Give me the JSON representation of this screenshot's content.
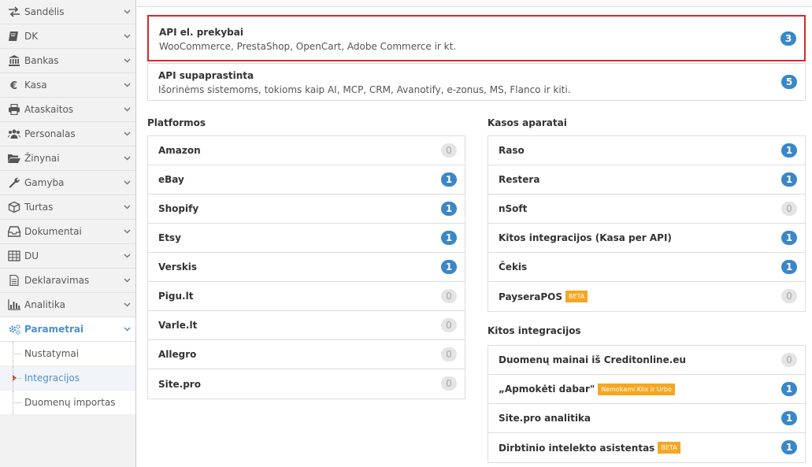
{
  "sidebar": {
    "items": [
      {
        "label": "Sandėlis",
        "icon": "transfer-arrows-icon"
      },
      {
        "label": "DK",
        "icon": "book-icon"
      },
      {
        "label": "Bankas",
        "icon": "bank-icon"
      },
      {
        "label": "Kasa",
        "icon": "euro-icon"
      },
      {
        "label": "Ataskaitos",
        "icon": "printer-icon"
      },
      {
        "label": "Personalas",
        "icon": "users-icon"
      },
      {
        "label": "Žinynai",
        "icon": "folder-open-icon"
      },
      {
        "label": "Gamyba",
        "icon": "wrench-icon"
      },
      {
        "label": "Turtas",
        "icon": "cube-icon"
      },
      {
        "label": "Dokumentai",
        "icon": "inbox-icon"
      },
      {
        "label": "DU",
        "icon": "table-icon"
      },
      {
        "label": "Deklaravimas",
        "icon": "document-icon"
      },
      {
        "label": "Analitika",
        "icon": "bar-chart-icon"
      },
      {
        "label": "Parametrai",
        "icon": "gears-icon"
      }
    ],
    "sub_items": [
      {
        "label": "Nustatymai"
      },
      {
        "label": "Integracijos"
      },
      {
        "label": "Duomenų importas"
      }
    ]
  },
  "api": [
    {
      "title": "API el. prekybai",
      "description": "WooCommerce, PrestaShop, OpenCart, Adobe Commerce ir kt.",
      "count": "3"
    },
    {
      "title": "API supaprastinta",
      "description": "Išorinėms sistemoms, tokioms kaip AI, MCP, CRM, Avanotify, e-zonus, MS, Flanco ir kiti.",
      "count": "5"
    }
  ],
  "platformos": {
    "title": "Platformos",
    "items": [
      {
        "name": "Amazon",
        "count": "0"
      },
      {
        "name": "eBay",
        "count": "1"
      },
      {
        "name": "Shopify",
        "count": "1"
      },
      {
        "name": "Etsy",
        "count": "1"
      },
      {
        "name": "Verskis",
        "count": "1"
      },
      {
        "name": "Pigu.lt",
        "count": "0"
      },
      {
        "name": "Varle.lt",
        "count": "0"
      },
      {
        "name": "Allegro",
        "count": "0"
      },
      {
        "name": "Site.pro",
        "count": "0"
      }
    ]
  },
  "kasos": {
    "title": "Kasos aparatai",
    "items": [
      {
        "name": "Raso",
        "count": "1",
        "tag": ""
      },
      {
        "name": "Restera",
        "count": "1",
        "tag": ""
      },
      {
        "name": "nSoft",
        "count": "0",
        "tag": ""
      },
      {
        "name": "Kitos integracijos (Kasa per API)",
        "count": "1",
        "tag": ""
      },
      {
        "name": "Čekis",
        "count": "1",
        "tag": ""
      },
      {
        "name": "PayseraPOS",
        "count": "0",
        "tag": "BETA"
      }
    ]
  },
  "kitos": {
    "title": "Kitos integracijos",
    "items": [
      {
        "name": "Duomenų mainai iš Creditonline.eu",
        "count": "0",
        "tag": ""
      },
      {
        "name": "„Apmokėti dabar\"",
        "count": "1",
        "tag": "Nemokami Klix ir Urbo"
      },
      {
        "name": "Site.pro analitika",
        "count": "1",
        "tag": ""
      },
      {
        "name": "Dirbtinio intelekto asistentas",
        "count": "1",
        "tag": "BETA"
      }
    ]
  },
  "colors": {
    "accent": "#4d8fcf",
    "badge": "#3a87c8",
    "highlight_border": "#d9262c",
    "tag": "#f5a623"
  }
}
